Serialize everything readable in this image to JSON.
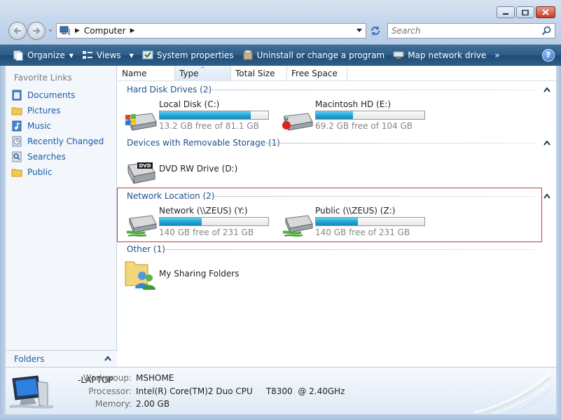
{
  "window": {
    "minimize_icon": "minimize-icon",
    "maximize_icon": "maximize-icon",
    "close_icon": "close-icon"
  },
  "address": {
    "location": "Computer",
    "search_placeholder": "Search"
  },
  "toolbar": {
    "organize": "Organize",
    "views": "Views",
    "system_properties": "System properties",
    "uninstall": "Uninstall or change a program",
    "map_drive": "Map network drive",
    "more": "»",
    "help": "?"
  },
  "sidebar": {
    "title": "Favorite Links",
    "items": [
      {
        "label": "Documents",
        "icon": "documents-icon"
      },
      {
        "label": "Pictures",
        "icon": "pictures-folder-icon"
      },
      {
        "label": "Music",
        "icon": "music-icon"
      },
      {
        "label": "Recently Changed",
        "icon": "recently-changed-icon"
      },
      {
        "label": "Searches",
        "icon": "searches-icon"
      },
      {
        "label": "Public",
        "icon": "public-folder-icon"
      }
    ],
    "folders_label": "Folders"
  },
  "columns": [
    "Name",
    "Type",
    "Total Size",
    "Free Space"
  ],
  "groups": {
    "hdd": {
      "title": "Hard Disk Drives (2)",
      "drives": [
        {
          "name": "Local Disk (C:)",
          "free": "13.2 GB free of 81.1 GB",
          "used_fraction": 0.84
        },
        {
          "name": "Macintosh HD (E:)",
          "free": "69.2 GB free of 104 GB",
          "used_fraction": 0.34
        }
      ]
    },
    "removable": {
      "title": "Devices with Removable Storage (1)",
      "drives": [
        {
          "name": "DVD RW Drive (D:)",
          "label": "DVD"
        }
      ]
    },
    "network": {
      "title": "Network Location (2)",
      "drives": [
        {
          "name": "Network (\\\\ZEUS) (Y:)",
          "free": "140 GB free of 231 GB",
          "used_fraction": 0.39
        },
        {
          "name": "Public (\\\\ZEUS) (Z:)",
          "free": "140 GB free of 231 GB",
          "used_fraction": 0.39
        }
      ]
    },
    "other": {
      "title": "Other (1)",
      "items": [
        {
          "name": "My Sharing Folders"
        }
      ]
    }
  },
  "details": {
    "computer_name": "-LAPTOP",
    "workgroup_label": "Workgroup:",
    "workgroup": "MSHOME",
    "processor_label": "Processor:",
    "processor": "Intel(R) Core(TM)2 Duo CPU     T8300  @ 2.40GHz",
    "memory_label": "Memory:",
    "memory": "2.00 GB"
  },
  "colors": {
    "toolbar": "#2d5c86",
    "link": "#1a5ea8",
    "group_title": "#1e4f8c",
    "bar_fill": "#26a6d6",
    "highlight_border": "#c63b3b"
  }
}
